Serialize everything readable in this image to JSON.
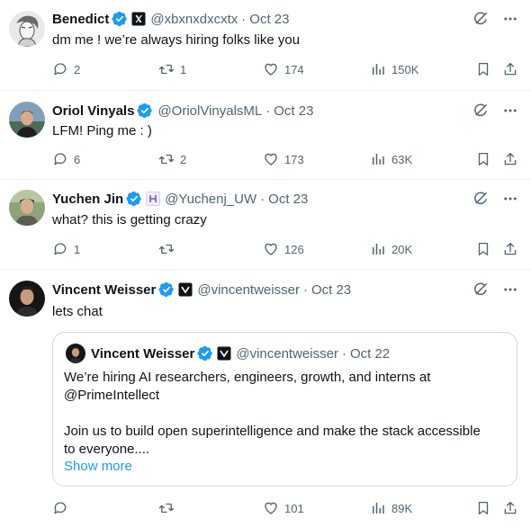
{
  "tweets": [
    {
      "name": "Benedict",
      "handle": "@xbxnxdxcxtx",
      "time": "Oct 23",
      "text": "dm me ! we’re always hiring folks like you",
      "replies": "2",
      "retweets": "1",
      "likes": "174",
      "views": "150K"
    },
    {
      "name": "Oriol Vinyals",
      "handle": "@OriolVinyalsML",
      "time": "Oct 23",
      "text": "LFM! Ping me : )",
      "replies": "6",
      "retweets": "2",
      "likes": "173",
      "views": "63K"
    },
    {
      "name": "Yuchen Jin",
      "handle": "@Yuchenj_UW",
      "time": "Oct 23",
      "text": "what? this is getting crazy",
      "replies": "1",
      "retweets": "",
      "likes": "126",
      "views": "20K"
    },
    {
      "name": "Vincent Weisser",
      "handle": "@vincentweisser",
      "time": "Oct 23",
      "text": "lets chat",
      "replies": "",
      "retweets": "",
      "likes": "101",
      "views": "89K"
    }
  ],
  "quote": {
    "name": "Vincent Weisser",
    "handle": "@vincentweisser",
    "time": "Oct 22",
    "line1": "We’re hiring AI researchers, engineers, growth, and interns at",
    "line2": "@PrimeIntellect",
    "line3": "Join us to build open superintelligence and make the stack accessible",
    "line4": "to everyone....",
    "show_more": "Show more"
  },
  "separator": "·",
  "colors": {
    "text": "#0f1419",
    "muted": "#536471",
    "verified": "#1d9bf0",
    "link": "#1d9bf0",
    "border": "#cfd9de"
  },
  "icons": [
    "reply-icon",
    "retweet-icon",
    "like-icon",
    "views-icon",
    "bookmark-icon",
    "share-icon",
    "grok-icon",
    "more-icon",
    "verified-badge-icon"
  ]
}
